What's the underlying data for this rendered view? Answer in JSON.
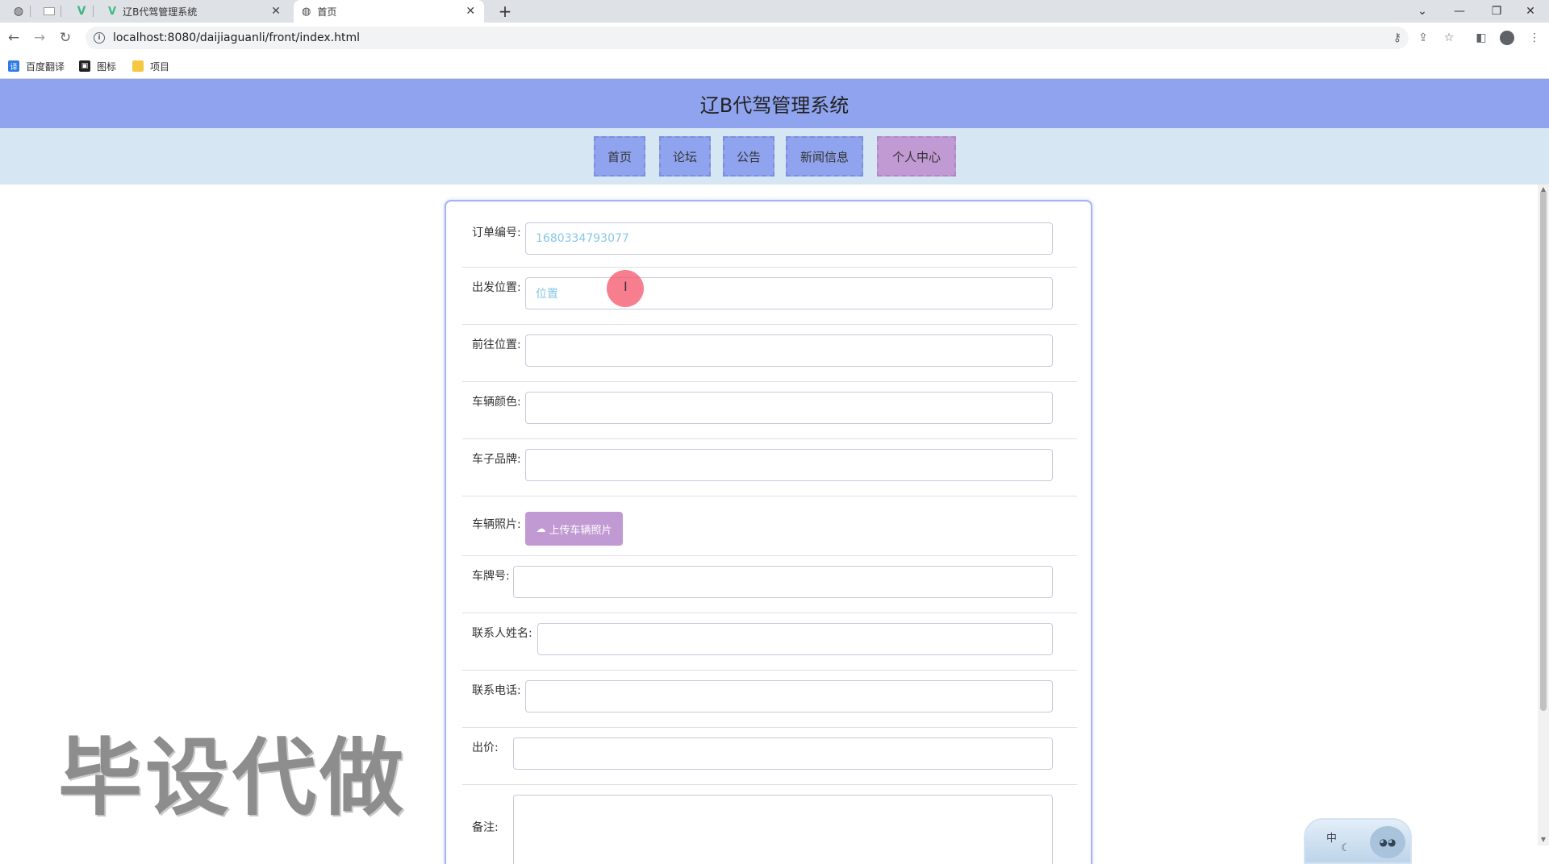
{
  "browser": {
    "tabs": [
      {
        "title": "辽B代驾管理系统",
        "active": false
      },
      {
        "title": "首页",
        "active": true
      }
    ],
    "close_glyph": "✕",
    "new_tab_glyph": "+",
    "url": "localhost:8080/daijiaguanli/front/index.html",
    "info_glyph": "i",
    "bookmarks": [
      {
        "label": "百度翻译",
        "icon": "translate-icon"
      },
      {
        "label": "图标",
        "icon": "image-icon"
      },
      {
        "label": "项目",
        "icon": "folder-icon"
      }
    ]
  },
  "site": {
    "title": "辽B代驾管理系统",
    "nav": [
      {
        "label": "首页",
        "active": false
      },
      {
        "label": "论坛",
        "active": false
      },
      {
        "label": "公告",
        "active": false
      },
      {
        "label": "新闻信息",
        "active": false
      },
      {
        "label": "个人中心",
        "active": true
      }
    ]
  },
  "form": {
    "order_no": {
      "label": "订单编号:",
      "value": "1680334793077"
    },
    "start": {
      "label": "出发位置:",
      "value": "位置"
    },
    "destination": {
      "label": "前往位置:",
      "value": ""
    },
    "car_color": {
      "label": "车辆颜色:",
      "value": ""
    },
    "car_brand": {
      "label": "车子品牌:",
      "value": ""
    },
    "car_photo": {
      "label": "车辆照片:",
      "button": "上传车辆照片"
    },
    "plate": {
      "label": "车牌号:",
      "value": ""
    },
    "contact_name": {
      "label": "联系人姓名:",
      "value": ""
    },
    "contact_phone": {
      "label": "联系电话:",
      "value": ""
    },
    "price": {
      "label": "出价:",
      "value": ""
    },
    "remark": {
      "label": "备注:",
      "value": ""
    }
  },
  "overlay": {
    "watermark": "毕设代做",
    "ime_label": "中"
  },
  "colors": {
    "header": "#8fa3ee",
    "nav_bg": "#d7e6f3",
    "nav_active": "#c19ad3",
    "input_text": "#87c7e6"
  }
}
